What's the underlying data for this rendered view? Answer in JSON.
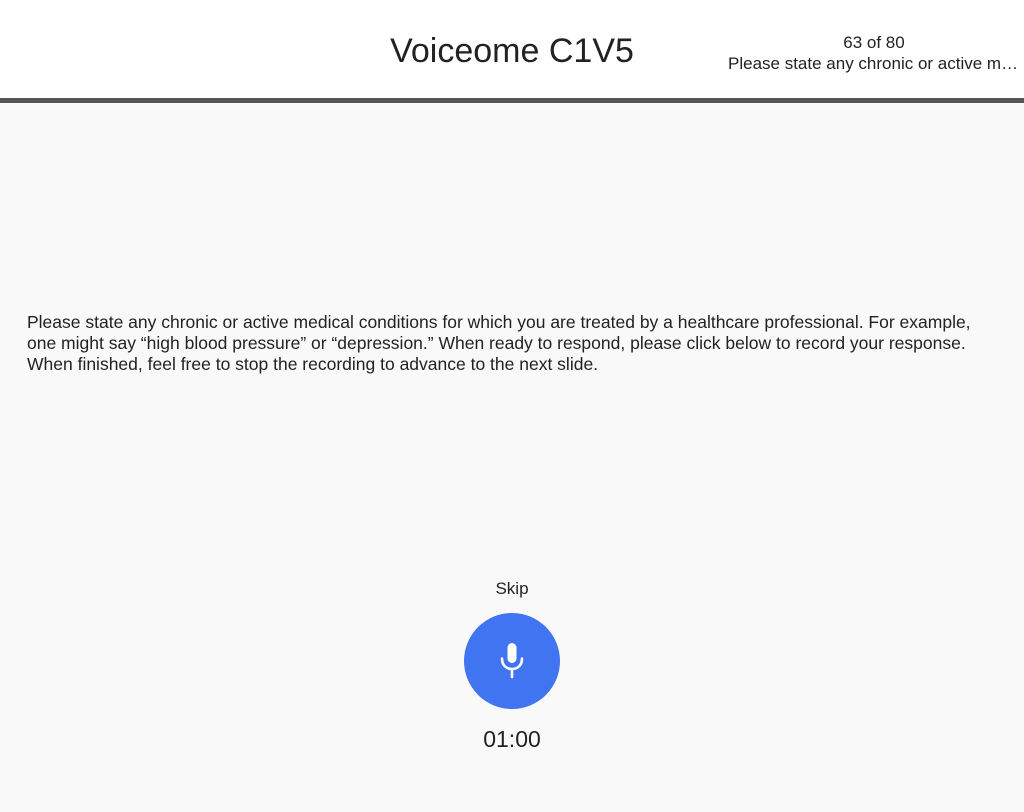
{
  "header": {
    "title": "Voiceome C1V5",
    "progress_count": "63 of 80",
    "progress_summary": "Please state any chronic or active medical conditions for which you are treated by a healthcare professional."
  },
  "prompt": {
    "text": "Please state any chronic or active medical conditions for which you are treated by a healthcare professional. For example, one might say “high blood pressure” or “depression.” When ready to respond, please click below to record your response. When finished, feel free to stop the recording to advance to the next slide."
  },
  "controls": {
    "skip_label": "Skip",
    "record_icon": "microphone-icon",
    "timer": "01:00"
  },
  "colors": {
    "accent": "#4174f1",
    "header_border": "#555555",
    "background": "#f9f9f9"
  }
}
